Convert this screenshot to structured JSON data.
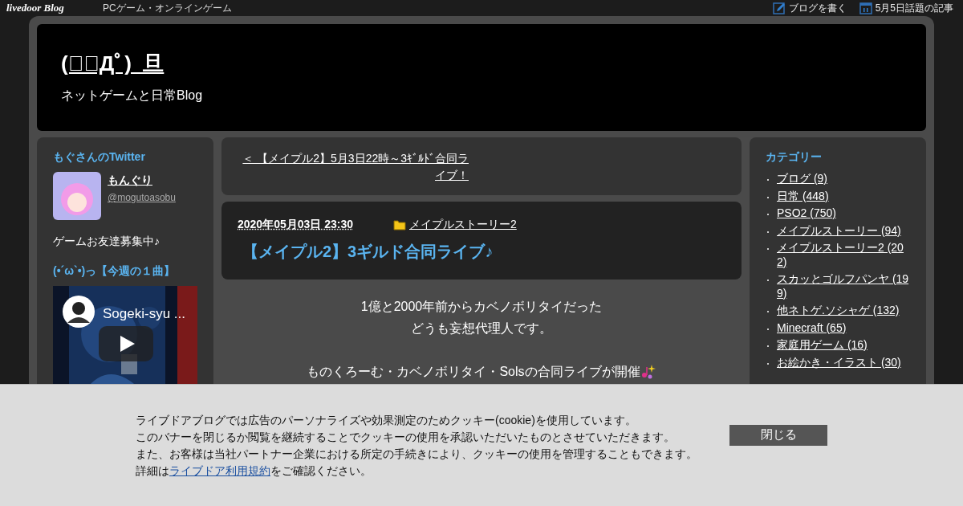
{
  "top_bar": {
    "logo": "livedoor Blog",
    "genre": "PCゲーム・オンラインゲーム",
    "links": [
      {
        "label": "ブログを書く"
      },
      {
        "label": "5月5日話題の記事"
      }
    ]
  },
  "header": {
    "title": "(；ﾟДﾟ)_旦",
    "subtitle": "ネットゲームと日常Blog"
  },
  "left_sidebar": {
    "twitter_heading": "もぐさんのTwitter",
    "profile_name": "もんぐり",
    "profile_handle": "@mogutoasobu",
    "profile_bio": "ゲームお友達募集中♪",
    "song_heading": "(•´ω`•)っ【今週の１曲】",
    "video": {
      "kind": "picture",
      "title": "Sogeki-syu ..."
    }
  },
  "prev_link": "＜ 【メイプル2】5月3日22時～3ｷﾞﾙﾄﾞ合同ライブ！",
  "post": {
    "date": "2020年05月03日 23:30",
    "category": "メイプルストーリー2",
    "title": "【メイプル2】3ギルド合同ライブ♪",
    "paragraphs": [
      [
        "1億と2000年前からカベノボリタイだった",
        "どうも妄想代理人です。"
      ],
      [
        "ものくろーむ・カベノボリタイ・Solsの合同ライブが開催"
      ]
    ]
  },
  "categories": {
    "heading": "カテゴリー",
    "items": [
      "ブログ (9)",
      "日常 (448)",
      "PSO2 (750)",
      "メイプルストーリー (94)",
      "メイプルストーリー2 (202)",
      "スカッとゴルフパンヤ (199)",
      "他ネトゲ.ソシャゲ (132)",
      "Minecraft (65)",
      "家庭用ゲーム (16)",
      "お絵かき・イラスト (30)"
    ]
  },
  "cookie_banner": {
    "lines": [
      "ライブドアブログでは広告のパーソナライズや効果測定のためクッキー(cookie)を使用しています。",
      "このバナーを閉じるか閲覧を継続することでクッキーの使用を承認いただいたものとさせていただきます。",
      "また、お客様は当社パートナー企業における所定の手続きにより、クッキーの使用を管理することもできます。"
    ],
    "detail_before": "詳細は",
    "detail_link": "ライブドア利用規約",
    "detail_after": "をご確認ください。",
    "close_button": "閉じる"
  }
}
